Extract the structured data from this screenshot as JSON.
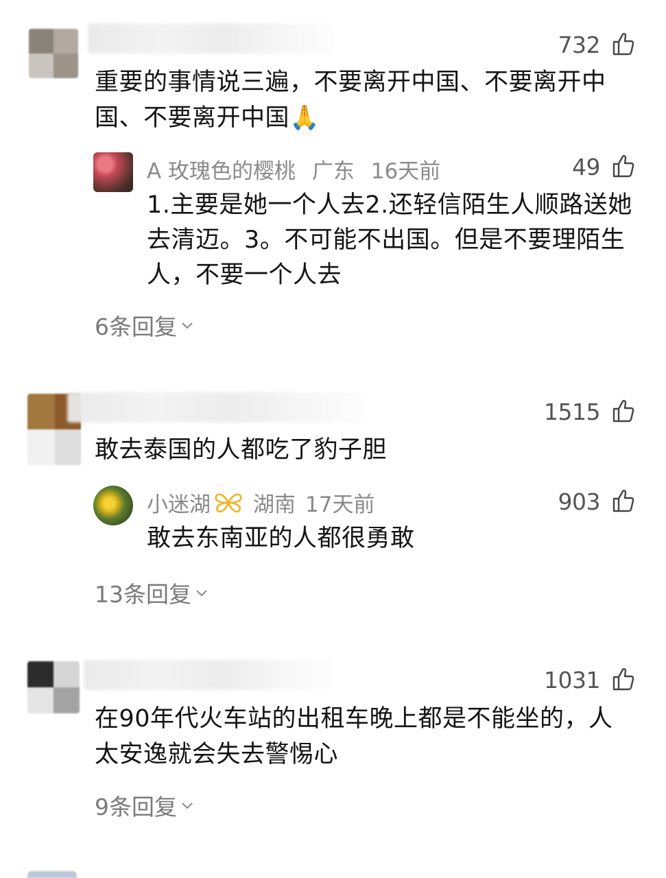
{
  "comments": [
    {
      "likes": "732",
      "text": "重要的事情说三遍，不要离开中国、不要离开中国、不要离开中国🙏",
      "reply": {
        "name": "A 玫瑰色的樱桃",
        "region": "广东",
        "time": "16天前",
        "likes": "49",
        "text": "1.主要是她一个人去2.还轻信陌生人顺路送她去清迈。3。不可能不出国。但是不要理陌生人，不要一个人去"
      },
      "replies_label": "6条回复"
    },
    {
      "likes": "1515",
      "text": "敢去泰国的人都吃了豹子胆",
      "reply": {
        "name": "小迷湖",
        "region": "湖南",
        "time": "17天前",
        "likes": "903",
        "text": "敢去东南亚的人都很勇敢"
      },
      "replies_label": "13条回复"
    },
    {
      "likes": "1031",
      "text": "在90年代火车站的出租车晚上都是不能坐的，人太安逸就会失去警惕心",
      "replies_label": "9条回复"
    }
  ],
  "icons": {
    "like": "thumbs-up-icon",
    "expand": "chevron-down-icon",
    "badge": "butterfly-icon"
  },
  "colors": {
    "text": "#141414",
    "meta": "#8a8a8a",
    "badge": "#f0b429"
  }
}
